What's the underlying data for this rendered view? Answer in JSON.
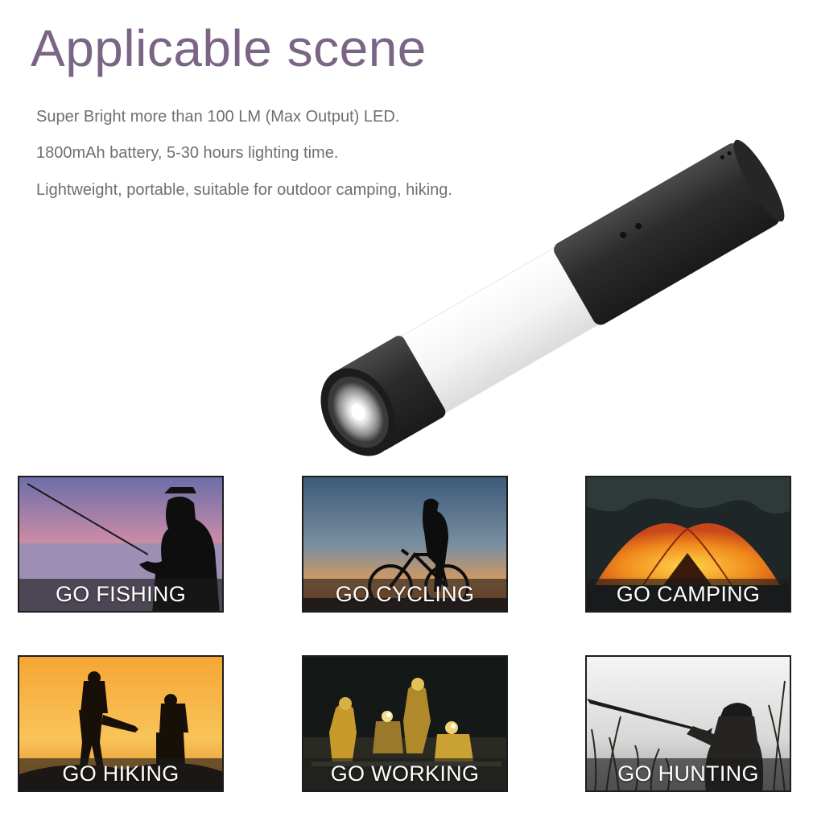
{
  "title": "Applicable scene",
  "features": [
    "Super Bright  more than 100 LM (Max Output) LED.",
    "1800mAh battery, 5-30 hours lighting time.",
    "Lightweight, portable, suitable for outdoor camping, hiking."
  ],
  "scenes": [
    {
      "label": "GO FISHING"
    },
    {
      "label": "GO CYCLING"
    },
    {
      "label": "GO CAMPING"
    },
    {
      "label": "GO HIKING"
    },
    {
      "label": "GO WORKING"
    },
    {
      "label": "GO HUNTING"
    }
  ],
  "colors": {
    "title": "#7a6585",
    "feature_text": "#6f6f6f",
    "caption_text": "#ffffff",
    "flashlight_body": "#2e2e2e",
    "flashlight_diffuser": "#f2f2f2"
  }
}
